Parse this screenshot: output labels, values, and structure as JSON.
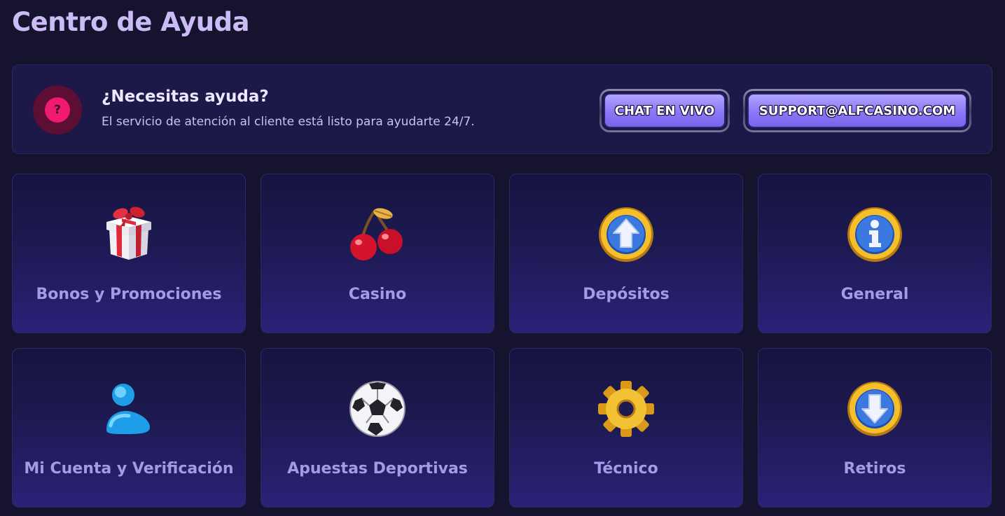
{
  "page_title": "Centro de Ayuda",
  "help": {
    "heading": "¿Necesitas ayuda?",
    "subtext": "El servicio de atención al cliente está listo para ayudarte 24/7.",
    "icon_glyph": "?",
    "chat_button": "CHAT EN VIVO",
    "email_button": "SUPPORT@ALFCASINO.COM"
  },
  "categories": [
    {
      "label": "Bonos y Promociones",
      "icon": "gift-icon"
    },
    {
      "label": "Casino",
      "icon": "cherries-icon"
    },
    {
      "label": "Depósitos",
      "icon": "arrow-up-coin-icon"
    },
    {
      "label": "General",
      "icon": "info-coin-icon"
    },
    {
      "label": "Mi Cuenta y Verificación",
      "icon": "user-icon"
    },
    {
      "label": "Apuestas Deportivas",
      "icon": "soccer-ball-icon"
    },
    {
      "label": "Técnico",
      "icon": "gear-icon"
    },
    {
      "label": "Retiros",
      "icon": "arrow-down-coin-icon"
    }
  ],
  "colors": {
    "background": "#16132e",
    "title": "#cbbcf5",
    "card_label": "#a49be4",
    "accent_pink": "#f01a73",
    "button_purple": "#8a78f6"
  }
}
